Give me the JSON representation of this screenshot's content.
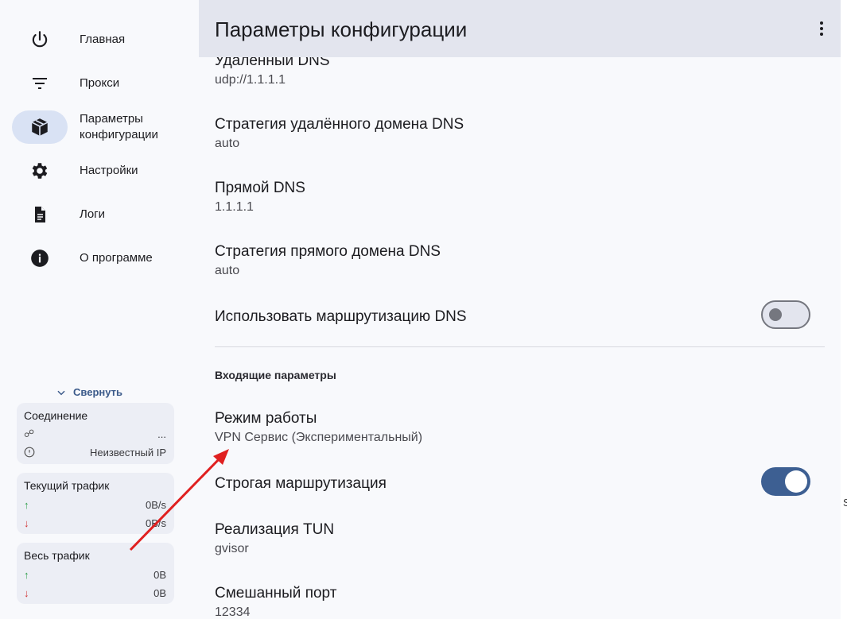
{
  "sidebar": {
    "items": [
      {
        "label": "Главная",
        "icon": "power-icon"
      },
      {
        "label": "Прокси",
        "icon": "filter-list-icon"
      },
      {
        "label": "Параметры конфигурации",
        "icon": "package-icon",
        "active": true
      },
      {
        "label": "Настройки",
        "icon": "gear-icon"
      },
      {
        "label": "Логи",
        "icon": "document-icon"
      },
      {
        "label": "О программе",
        "icon": "info-icon"
      }
    ],
    "collapse_label": "Свернуть",
    "connection": {
      "title": "Соединение",
      "value1": "...",
      "value2": "Неизвестный IP"
    },
    "current_traffic": {
      "title": "Текущий трафик",
      "up": "0B/s",
      "down": "0B/s",
      "up_glyph": "↑",
      "down_glyph": "↓"
    },
    "total_traffic": {
      "title": "Весь трафик",
      "up": "0B",
      "down": "0B",
      "up_glyph": "↑",
      "down_glyph": "↓"
    }
  },
  "header": {
    "title": "Параметры конфигурации"
  },
  "settings": {
    "remote_dns": {
      "name": "Удаленный DNS",
      "value": "udp://1.1.1.1"
    },
    "remote_dns_strategy": {
      "name": "Стратегия удалённого домена DNS",
      "value": "auto"
    },
    "direct_dns": {
      "name": "Прямой DNS",
      "value": "1.1.1.1"
    },
    "direct_dns_strategy": {
      "name": "Стратегия прямого домена DNS",
      "value": "auto"
    },
    "dns_routing": {
      "name": "Использовать маршрутизацию DNS",
      "enabled": false
    },
    "inbound_section": "Входящие параметры",
    "mode": {
      "name": "Режим работы",
      "value": "VPN Сервис (Экспериментальный)"
    },
    "strict_routing": {
      "name": "Строгая маршрутизация",
      "enabled": true
    },
    "tun_impl": {
      "name": "Реализация TUN",
      "value": "gvisor"
    },
    "mixed_port": {
      "name": "Смешанный порт",
      "value": "12334"
    }
  },
  "stray_char": "S",
  "colors": {
    "accent": "#3d5f92",
    "annotation_arrow": "#e02020"
  }
}
